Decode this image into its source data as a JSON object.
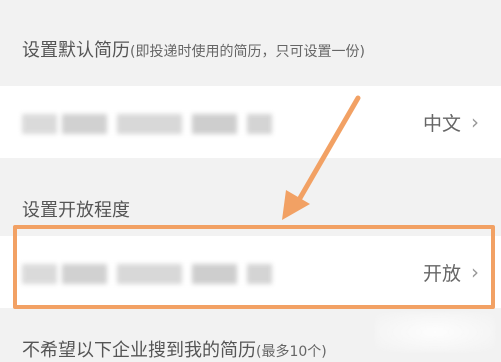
{
  "sections": {
    "default_resume": {
      "title": "设置默认简历",
      "note": "(即投递时使用的简历，只可设置一份)",
      "row": {
        "value": "中文"
      }
    },
    "openness": {
      "title": "设置开放程度",
      "row": {
        "value": "开放"
      }
    },
    "block_companies": {
      "title": "不希望以下企业搜到我的简历",
      "note": "(最多10个)"
    }
  },
  "colors": {
    "annotation": "#f2a164",
    "row_bg": "#ffffff",
    "page_bg": "#f2f2f2"
  },
  "icons": {
    "chevron": "chevron-right-icon",
    "arrow": "annotation-arrow"
  }
}
